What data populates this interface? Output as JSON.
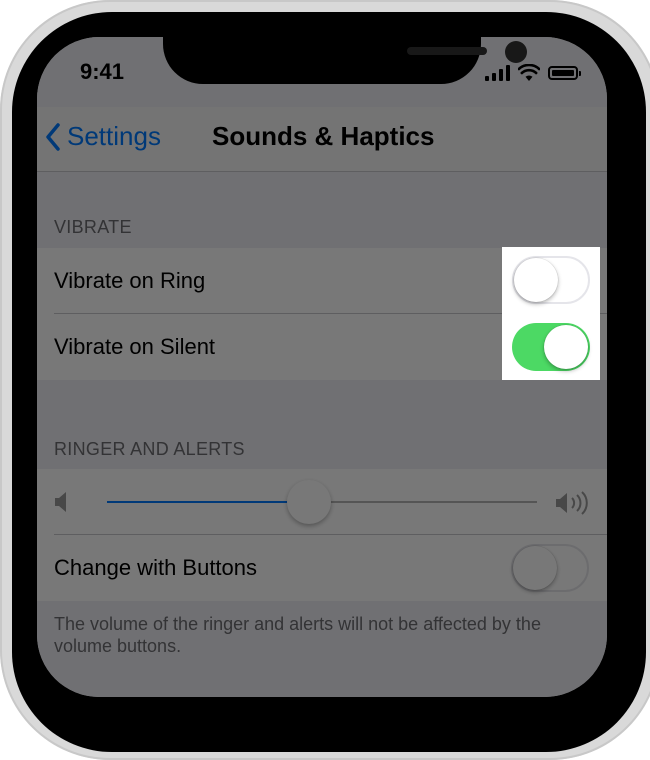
{
  "status_bar": {
    "time": "9:41"
  },
  "nav": {
    "back_label": "Settings",
    "title": "Sounds & Haptics"
  },
  "vibrate": {
    "header": "VIBRATE",
    "rows": [
      {
        "label": "Vibrate on Ring",
        "on": false
      },
      {
        "label": "Vibrate on Silent",
        "on": true
      }
    ]
  },
  "ringer": {
    "header": "RINGER AND ALERTS",
    "volume_level": 0.47,
    "change_with_buttons_label": "Change with Buttons",
    "change_with_buttons_on": false,
    "footer_note": "The volume of the ringer and alerts will not be affected by the volume buttons."
  },
  "colors": {
    "accent": "#007aff",
    "toggle_on": "#4cd964",
    "overlay": "rgba(0,0,0,0.53)"
  },
  "icons": [
    "chevron-left-icon",
    "cellular-signal-icon",
    "wifi-icon",
    "battery-icon",
    "speaker-low-icon",
    "speaker-high-icon"
  ]
}
